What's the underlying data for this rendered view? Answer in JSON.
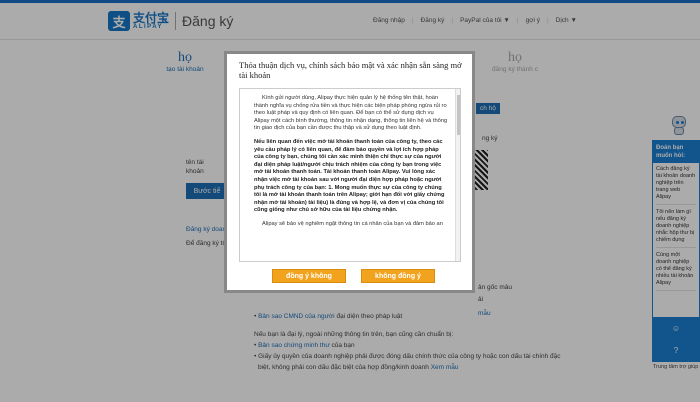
{
  "header": {
    "logo_cn": "支付宝",
    "logo_en": "ALIPAY",
    "page_heading": "Đăng ký",
    "nav": {
      "login": "Đăng nhập",
      "register": "Đăng ký",
      "paypal": "PayPal của tôi ▼",
      "sep_char": "|",
      "suggest": "gợi ý",
      "more": "Dịch ▼"
    }
  },
  "steps": [
    {
      "num": "họ",
      "label": "tạo tài khoản"
    },
    {
      "num": "họ",
      "label": ""
    },
    {
      "num": "họ",
      "label": "đăng ký thành c"
    }
  ],
  "background": {
    "account_label": "tên tài khoản",
    "next_button": "Bước tiế",
    "business_register": "Đăng ký doanh",
    "registered_note": "Để đăng ký tổ",
    "side_text_1": "ng ký",
    "side_text_2": "ản gốc mâu",
    "side_text_3": "ải",
    "side_text_4": "mẫu",
    "cmnd_link": "Bản sao CMND của người",
    "cmnd_rest": "đại diện theo pháp luật",
    "agent_line": "Nếu bạn là đại lý, ngoài những thông tin trên, bạn cũng cần chuẩn bị:",
    "identity_link": "Bản sao chứng minh thư",
    "identity_rest": "của bạn",
    "authorization": "Giấy ủy quyền của doanh nghiệp phải được đóng dấu chính thức của công ty hoặc con dấu tài chính đặc",
    "authorization_2": "biệt, không phải con dấu đặc biệt của hợp đồng/kinh doanh",
    "view_sample": "Xem mẫu",
    "bank_tab": "ch hộ"
  },
  "modal": {
    "title": "Thỏa thuận dịch vụ, chính sách bảo mật và xác nhận sẵn sàng mở tài khoản",
    "paragraphs": [
      {
        "text": "Kính gửi người dùng, Alipay thực hiện quản lý hệ thống tên thật, hoàn thành nghĩa vụ chống rửa tiền và thực hiện các biện pháp phòng ngừa rủi ro theo luật pháp và quy định có liên quan. Để bạn có thể sử dụng dịch vụ Alipay một cách bình thường, thông tin nhận dạng, thông tin liên hệ và thông tin giao dịch của bạn cần được thu thập và sử dụng theo luật định.",
        "bold": false
      },
      {
        "text": "Nếu liên quan đến việc mở tài khoản thanh toán của công ty, theo các yêu cầu pháp lý có liên quan, để đảm bảo quyền và lợi ích hợp pháp của công ty bạn, chúng tôi cần xác minh thiện chí thực sự của người đại diện pháp luật/người chịu trách nhiệm của công ty bạn trong việc mở tài khoản thanh toán. Tài khoản thanh toán Alipay. Vui lòng xác nhận việc mở tài khoản sau với người đại diện hợp pháp hoặc người phụ trách công ty của bạn: 1. Mong muốn thực sự của công ty chúng tôi là mở tài khoản thanh toán trên Alipay; giới hạn đối với giấy chứng nhận mở tài khoản) tài liệu) là đúng và hợp lệ, và đơn vị của chúng tôi cũng giống như chủ sở hữu của tài liệu chứng nhận.",
        "bold": true
      },
      {
        "text": "Alipay sẽ bảo vệ nghiêm ngặt thông tin cá nhân của bạn và đảm bảo an",
        "bold": false
      }
    ],
    "agree_button": "đồng ý không",
    "disagree_button": "không đồng ý"
  },
  "helper": {
    "title": "Đoán bạn muốn hỏi:",
    "items": [
      "Cách đăng ký tài khoản doanh nghiệp trên trang web Alipay",
      "Tôi nên làm gì nếu đăng ký doanh nghiệp nhắc hộp thư bị chiếm dụng",
      "Cùng một doanh nghiệp có thể đăng ký nhiều tài khoản Alipay"
    ],
    "support": "Trung tâm trợ giúp"
  }
}
